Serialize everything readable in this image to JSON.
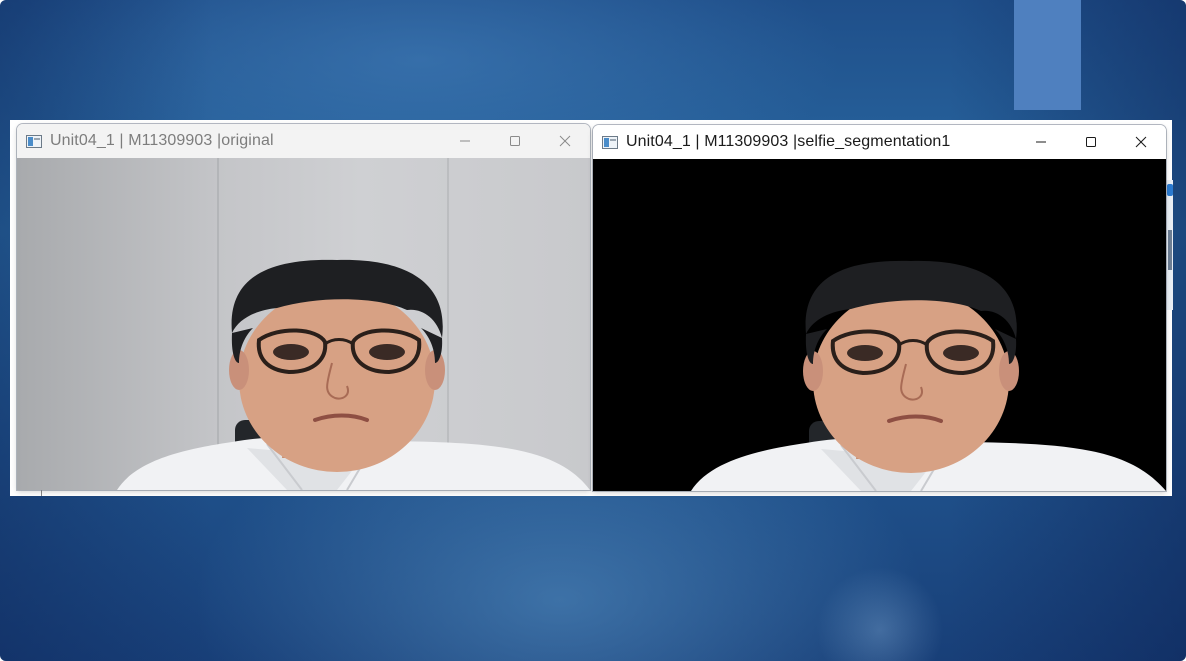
{
  "windows": [
    {
      "id": "original",
      "title": "Unit04_1 | M11309903 |original",
      "content": "webcam-frame-original",
      "controls": [
        "minimize-icon",
        "maximize-icon",
        "close-icon"
      ]
    },
    {
      "id": "selfie_segmentation1",
      "title": "Unit04_1 | M11309903 |selfie_segmentation1",
      "content": "webcam-frame-segmented",
      "controls": [
        "minimize-icon",
        "maximize-icon",
        "close-icon"
      ]
    }
  ],
  "colors": {
    "slide_background": "#2a6aa3",
    "accent_rect": "#4f80bf",
    "title_inactive": "#7d7d7d",
    "title_active": "#1b1b1b",
    "segmentation_background": "#000000"
  }
}
